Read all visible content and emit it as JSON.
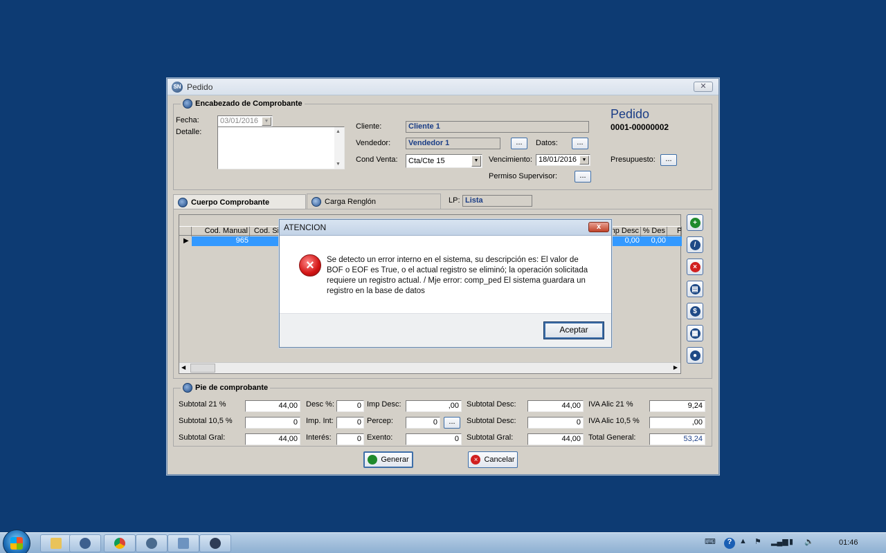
{
  "window": {
    "title": "Pedido",
    "icon_text": "SN"
  },
  "header": {
    "section_title": "Encabezado de Comprobante",
    "fecha_label": "Fecha:",
    "fecha_value": "03/01/2016",
    "detalle_label": "Detalle:",
    "cliente_label": "Cliente:",
    "cliente_value": "Cliente 1",
    "vendedor_label": "Vendedor:",
    "vendedor_value": "Vendedor 1",
    "vendedor_btn": "...",
    "datos_label": "Datos:",
    "datos_btn": "...",
    "cond_venta_label": "Cond Venta:",
    "cond_venta_value": "Cta/Cte 15",
    "vencimiento_label": "Vencimiento:",
    "vencimiento_value": "18/01/2016",
    "permiso_label": "Permiso Supervisor:",
    "permiso_btn": "...",
    "doc_type": "Pedido",
    "doc_number": "0001-00000002",
    "presupuesto_label": "Presupuesto:",
    "presupuesto_btn": "..."
  },
  "tabs": [
    {
      "label": "Cuerpo Comprobante",
      "active": true
    },
    {
      "label": "Carga Renglón",
      "active": false
    }
  ],
  "lp": {
    "label": "LP:",
    "value": "Lista"
  },
  "grid": {
    "columns": [
      "Cod. Manual",
      "Cod. Si",
      "mp Desc",
      "% Des",
      "P"
    ],
    "row": {
      "cod_manual": "965",
      "imp_desc": "0,00",
      "pct_desc": "0,00"
    }
  },
  "footer": {
    "section_title": "Pie de comprobante",
    "subtotal_21_label": "Subtotal  21 %",
    "subtotal_21_value": "44,00",
    "subtotal_105_label": "Subtotal  10,5 %",
    "subtotal_105_value": "0",
    "subtotal_gral_label": "Subtotal Gral:",
    "subtotal_gral_value": "44,00",
    "desc_pct_label": "Desc %:",
    "desc_pct_value": "0",
    "imp_int_label": "Imp. Int:",
    "imp_int_value": "0",
    "interes_label": "Interés:",
    "interes_value": "0",
    "imp_desc_label": "Imp Desc:",
    "imp_desc_value": ",00",
    "percep_label": "Percep:",
    "percep_value": "0",
    "percep_btn": "...",
    "exento_label": "Exento:",
    "exento_value": "0",
    "subtotal_desc1_label": "Subtotal Desc:",
    "subtotal_desc1_value": "44,00",
    "subtotal_desc2_label": "Subtotal Desc:",
    "subtotal_desc2_value": "0",
    "subtotal_gral2_label": "Subtotal Gral:",
    "subtotal_gral2_value": "44,00",
    "iva_21_label": "IVA Alic  21 %",
    "iva_21_value": "9,24",
    "iva_105_label": "IVA Alic  10,5 %",
    "iva_105_value": ",00",
    "total_label": "Total General:",
    "total_value": "53,24"
  },
  "actions": {
    "generar": "Generar",
    "cancelar": "Cancelar"
  },
  "dialog": {
    "title": "ATENCION",
    "close": "x",
    "message": "Se detecto un error interno en el sistema, su descripción es: El valor de BOF o EOF es True, o el actual registro se eliminó; la operación solicitada requiere un registro actual. / Mje error: comp_ped El sistema guardara un registro en la base de datos",
    "ok_button": "Aceptar"
  },
  "taskbar": {
    "clock": "01:46"
  }
}
